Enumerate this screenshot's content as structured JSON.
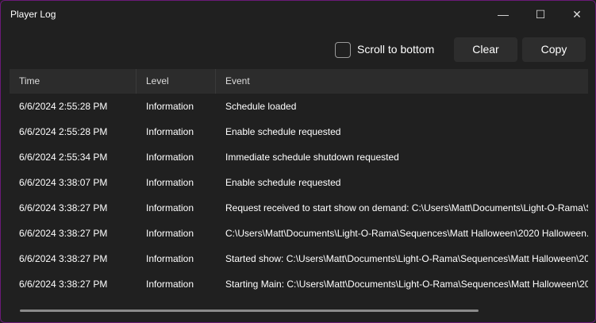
{
  "window": {
    "title": "Player Log",
    "minimize": "—",
    "maximize": "☐",
    "close": "✕"
  },
  "toolbar": {
    "scroll_label": "Scroll to bottom",
    "scroll_checked": false,
    "clear": "Clear",
    "copy": "Copy"
  },
  "columns": [
    "Time",
    "Level",
    "Event"
  ],
  "rows": [
    {
      "time": "6/6/2024 2:55:28 PM",
      "level": "Information",
      "event": "Schedule loaded"
    },
    {
      "time": "6/6/2024 2:55:28 PM",
      "level": "Information",
      "event": "Enable schedule requested"
    },
    {
      "time": "6/6/2024 2:55:34 PM",
      "level": "Information",
      "event": "Immediate schedule shutdown requested"
    },
    {
      "time": "6/6/2024 3:38:07 PM",
      "level": "Information",
      "event": "Enable schedule requested"
    },
    {
      "time": "6/6/2024 3:38:27 PM",
      "level": "Information",
      "event": "Request received to start show on demand: C:\\Users\\Matt\\Documents\\Light-O-Rama\\S"
    },
    {
      "time": "6/6/2024 3:38:27 PM",
      "level": "Information",
      "event": "C:\\Users\\Matt\\Documents\\Light-O-Rama\\Sequences\\Matt Halloween\\2020 Halloween."
    },
    {
      "time": "6/6/2024 3:38:27 PM",
      "level": "Information",
      "event": "Started show: C:\\Users\\Matt\\Documents\\Light-O-Rama\\Sequences\\Matt Halloween\\20"
    },
    {
      "time": "6/6/2024 3:38:27 PM",
      "level": "Information",
      "event": "Starting Main: C:\\Users\\Matt\\Documents\\Light-O-Rama\\Sequences\\Matt Halloween\\20"
    }
  ]
}
